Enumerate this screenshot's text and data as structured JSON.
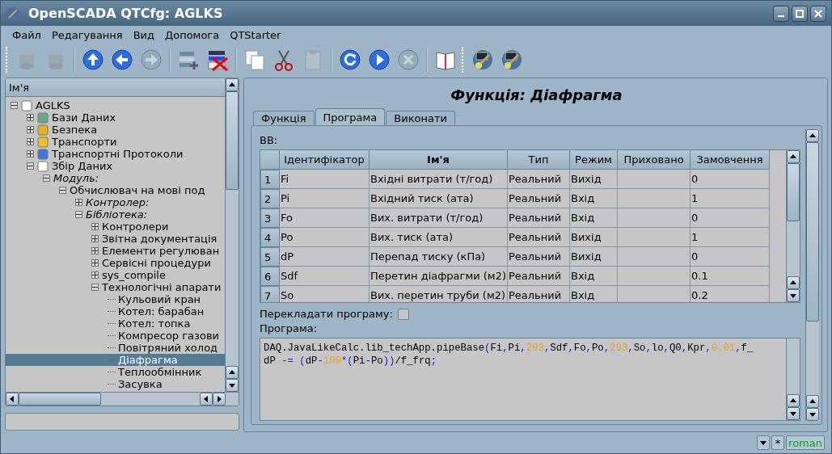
{
  "window": {
    "title": "OpenSCADA QTCfg: AGLKS"
  },
  "menu": [
    {
      "label": "Файл"
    },
    {
      "label": "Редагування"
    },
    {
      "label": "Вид"
    },
    {
      "label": "Допомога"
    },
    {
      "label": "QTStarter"
    }
  ],
  "toolbar": [
    [
      {
        "disabled": true
      },
      {
        "disabled": true
      }
    ],
    [
      {
        "disabled": false
      },
      {
        "disabled": false
      },
      {
        "disabled": true
      }
    ],
    [
      {
        "disabled": false
      },
      {
        "disabled": false
      }
    ],
    [
      {
        "disabled": false
      },
      {
        "disabled": false
      },
      {
        "disabled": true
      }
    ],
    [
      {
        "disabled": false
      },
      {
        "disabled": false
      },
      {
        "disabled": true
      }
    ],
    [
      {
        "disabled": false
      }
    ]
  ],
  "toolbar_modules": [
    {
      "disabled": false
    },
    {
      "disabled": false
    }
  ],
  "tree": {
    "header": "Ім'я",
    "items": [
      {
        "label": "AGLKS",
        "italic": false,
        "expanded": true,
        "children": [
          {
            "label": "Бази Даних",
            "italic": false,
            "expanded": false
          },
          {
            "label": "Безпека",
            "italic": false,
            "expanded": false
          },
          {
            "label": "Транспорти",
            "italic": false,
            "expanded": false
          },
          {
            "label": "Транспортні Протоколи",
            "italic": false,
            "expanded": false
          },
          {
            "label": "Збір Даних",
            "italic": false,
            "expanded": true,
            "children": [
              {
                "label": "Модуль:",
                "italic": true,
                "expanded": true,
                "children": [
                  {
                    "label": "Обчислювач на мові под",
                    "italic": false,
                    "expanded": true,
                    "children": [
                      {
                        "label": "Контролер:",
                        "italic": true,
                        "expanded": false
                      },
                      {
                        "label": "Бібліотека:",
                        "italic": true,
                        "expanded": true,
                        "children": [
                          {
                            "label": "Контролери",
                            "italic": false,
                            "expanded": false
                          },
                          {
                            "label": "Звітна документація",
                            "italic": false,
                            "expanded": false
                          },
                          {
                            "label": "Елементи регулюван",
                            "italic": false,
                            "expanded": false
                          },
                          {
                            "label": "Сервісні процедури",
                            "italic": false,
                            "expanded": false
                          },
                          {
                            "label": "sys_compile",
                            "italic": false,
                            "expanded": false
                          },
                          {
                            "label": "Технологічні апарати",
                            "italic": false,
                            "expanded": true,
                            "children": [
                              {
                                "label": "Кульовий кран",
                                "selected": false
                              },
                              {
                                "label": "Котел: барабан",
                                "selected": false
                              },
                              {
                                "label": "Котел: топка",
                                "selected": false
                              },
                              {
                                "label": "Компресор газови",
                                "selected": false
                              },
                              {
                                "label": "Повітряний холод",
                                "selected": false
                              },
                              {
                                "label": "Діафрагма",
                                "selected": true
                              },
                              {
                                "label": "Теплообмінник",
                                "selected": false
                              },
                              {
                                "label": "Засувка",
                                "selected": false
                              }
                            ]
                          }
                        ]
                      }
                    ]
                  }
                ]
              }
            ]
          }
        ]
      }
    ]
  },
  "page_title": "Функція: Діафрагма",
  "tabs": [
    {
      "label": "Функція",
      "selected": false
    },
    {
      "label": "Програма",
      "selected": true
    },
    {
      "label": "Виконати",
      "selected": false
    }
  ],
  "io_label": "ВВ:",
  "table": {
    "columns": [
      {
        "label": "Ідентифікатор",
        "highlighted": false
      },
      {
        "label": "Ім'я",
        "highlighted": true
      },
      {
        "label": "Тип",
        "highlighted": false
      },
      {
        "label": "Режим",
        "highlighted": false
      },
      {
        "label": "Приховано",
        "highlighted": false
      },
      {
        "label": "Замовчення",
        "highlighted": false
      }
    ],
    "rows": [
      {
        "number": "1",
        "cells": [
          "Fi",
          "Вхідні витрати (т/год)",
          "Реальний",
          "Вихід",
          "",
          "0"
        ]
      },
      {
        "number": "2",
        "cells": [
          "Pi",
          "Вхідний тиск (ата)",
          "Реальний",
          "Вхід",
          "",
          "1"
        ]
      },
      {
        "number": "3",
        "cells": [
          "Fo",
          "Вих. витрати (т/год)",
          "Реальний",
          "Вхід",
          "",
          "0"
        ]
      },
      {
        "number": "4",
        "cells": [
          "Po",
          "Вих. тиск (ата)",
          "Реальний",
          "Вихід",
          "",
          "1"
        ]
      },
      {
        "number": "5",
        "cells": [
          "dP",
          "Перепад тиску (кПа)",
          "Реальний",
          "Вихід",
          "",
          "0"
        ]
      },
      {
        "number": "6",
        "cells": [
          "Sdf",
          "Перетин діафрагми (м2)",
          "Реальний",
          "Вхід",
          "",
          "0.1"
        ]
      },
      {
        "number": "7",
        "cells": [
          "So",
          "Вих. перетин труби (м2)",
          "Реальний",
          "Вхід",
          "",
          "0.2"
        ]
      }
    ]
  },
  "translate": {
    "label": "Перекладати програму:",
    "checked": false
  },
  "program_label": "Програма:",
  "program": [
    [
      {
        "kind": "ident",
        "text": "DAQ.JavaLikeCalc.lib_techApp.pipeBase"
      },
      {
        "kind": "op",
        "text": "("
      },
      {
        "kind": "ident",
        "text": "Fi"
      },
      {
        "kind": "op",
        "text": ","
      },
      {
        "kind": "ident",
        "text": "Pi"
      },
      {
        "kind": "op",
        "text": ","
      },
      {
        "kind": "num",
        "text": "293"
      },
      {
        "kind": "op",
        "text": ","
      },
      {
        "kind": "ident",
        "text": "Sdf"
      },
      {
        "kind": "op",
        "text": ","
      },
      {
        "kind": "ident",
        "text": "Fo"
      },
      {
        "kind": "op",
        "text": ","
      },
      {
        "kind": "ident",
        "text": "Po"
      },
      {
        "kind": "op",
        "text": ","
      },
      {
        "kind": "num",
        "text": "293"
      },
      {
        "kind": "op",
        "text": ","
      },
      {
        "kind": "ident",
        "text": "So"
      },
      {
        "kind": "op",
        "text": ","
      },
      {
        "kind": "ident",
        "text": "lo"
      },
      {
        "kind": "op",
        "text": ","
      },
      {
        "kind": "ident",
        "text": "Q0"
      },
      {
        "kind": "op",
        "text": ","
      },
      {
        "kind": "ident",
        "text": "Kpr"
      },
      {
        "kind": "op",
        "text": ","
      },
      {
        "kind": "num",
        "text": "0.01"
      },
      {
        "kind": "op",
        "text": ","
      },
      {
        "kind": "ident",
        "text": "f_"
      }
    ],
    [
      {
        "kind": "ident",
        "text": "dP "
      },
      {
        "kind": "op",
        "text": "-="
      },
      {
        "kind": "op",
        "text": " ("
      },
      {
        "kind": "ident",
        "text": "dP"
      },
      {
        "kind": "op",
        "text": "-"
      },
      {
        "kind": "num",
        "text": "100"
      },
      {
        "kind": "op",
        "text": "*("
      },
      {
        "kind": "ident",
        "text": "Pi"
      },
      {
        "kind": "op",
        "text": "-"
      },
      {
        "kind": "ident",
        "text": "Po"
      },
      {
        "kind": "op",
        "text": "))"
      },
      {
        "kind": "ident",
        "text": "/f_frq"
      },
      {
        "kind": "op",
        "text": ";"
      }
    ]
  ],
  "status": {
    "star": "*",
    "user": "roman"
  }
}
